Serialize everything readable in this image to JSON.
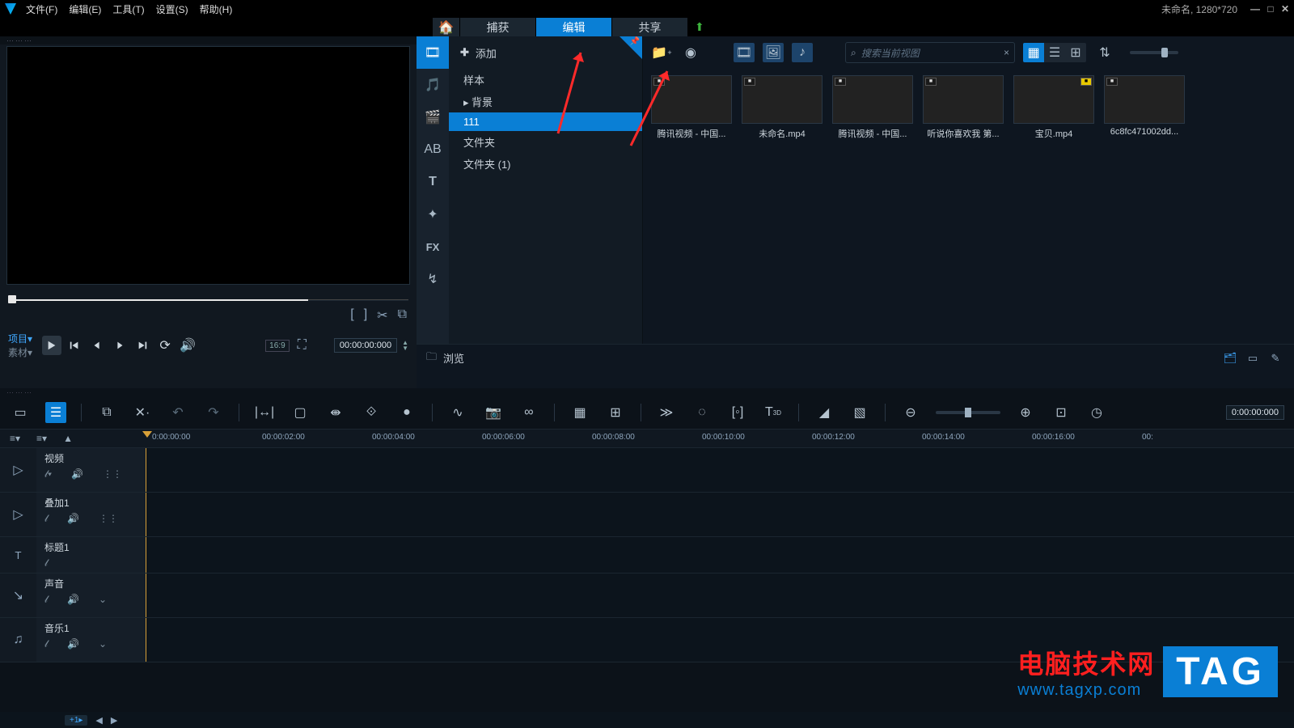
{
  "titlebar": {
    "menus": {
      "file": "文件(F)",
      "edit": "编辑(E)",
      "tools": "工具(T)",
      "settings": "设置(S)",
      "help": "帮助(H)"
    },
    "project_info": "未命名, 1280*720"
  },
  "modebar": {
    "capture": "捕获",
    "edit": "编辑",
    "share": "共享"
  },
  "preview": {
    "tab_project": "项目▾",
    "tab_material": "素材▾",
    "ratio": "16:9",
    "timecode": "00:00:00:000"
  },
  "library": {
    "add": "添加",
    "tree": {
      "sample": "样本",
      "background": "背景",
      "folder111": "111",
      "folder": "文件夹",
      "folder_1": "文件夹 (1)"
    },
    "search_placeholder": "搜索当前视图",
    "thumbs": [
      {
        "label": "腾讯视频 - 中国..."
      },
      {
        "label": "未命名.mp4"
      },
      {
        "label": "腾讯视频 - 中国..."
      },
      {
        "label": "听说你喜欢我 第..."
      },
      {
        "label": "宝贝.mp4"
      },
      {
        "label": "6c8fc471002dd..."
      }
    ],
    "browse": "浏览"
  },
  "timeline": {
    "timecode": "0:00:00:000",
    "ticks": [
      "0:00:00:00",
      "00:00:02:00",
      "00:00:04:00",
      "00:00:06:00",
      "00:00:08:00",
      "00:00:10:00",
      "00:00:12:00",
      "00:00:14:00",
      "00:00:16:00",
      "00:"
    ],
    "tracks": {
      "video": "视频",
      "overlay1": "叠加1",
      "title1": "标题1",
      "sound": "声音",
      "music1": "音乐1"
    },
    "add_track_label": "+1▸"
  },
  "watermark": {
    "line1": "电脑技术网",
    "line2": "www.tagxp.com",
    "tag": "TAG"
  }
}
